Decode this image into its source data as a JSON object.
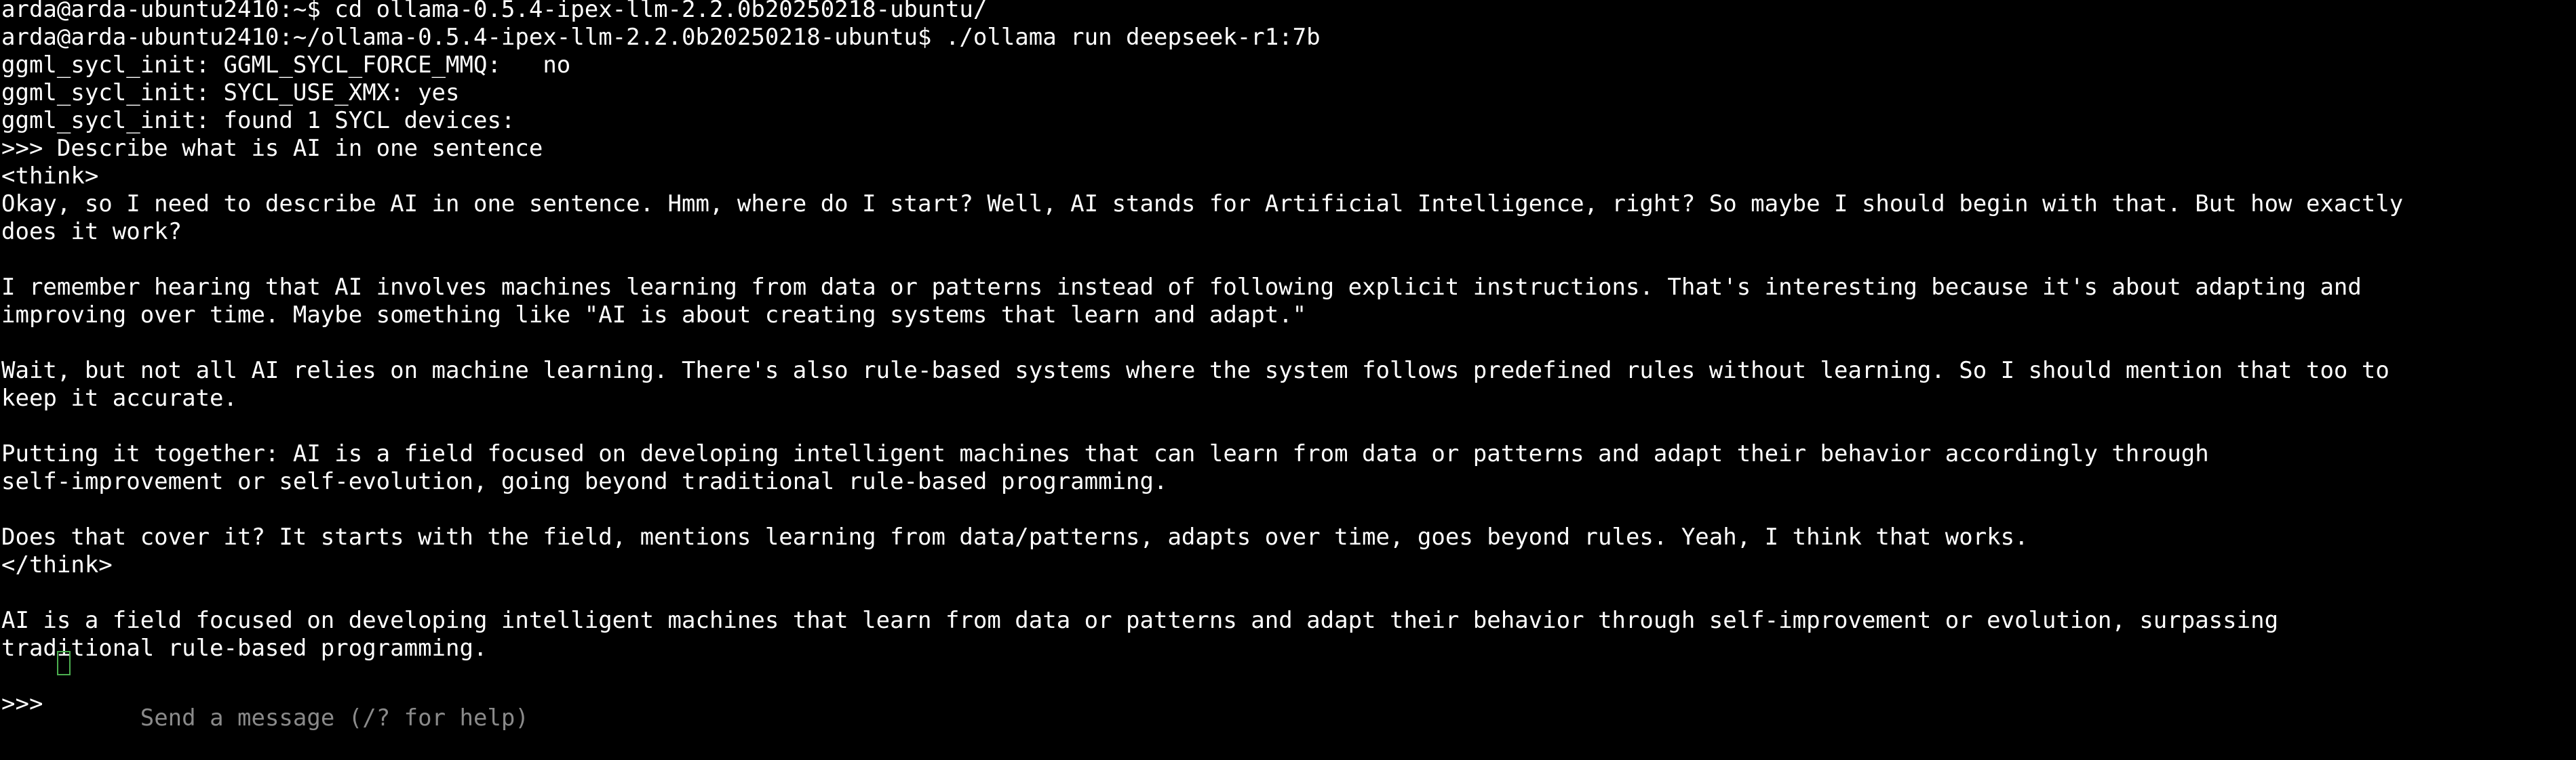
{
  "terminal": {
    "lines": [
      "arda@arda-ubuntu2410:~$ cd ollama-0.5.4-ipex-llm-2.2.0b20250218-ubuntu/",
      "arda@arda-ubuntu2410:~/ollama-0.5.4-ipex-llm-2.2.0b20250218-ubuntu$ ./ollama run deepseek-r1:7b",
      "ggml_sycl_init: GGML_SYCL_FORCE_MMQ:   no",
      "ggml_sycl_init: SYCL_USE_XMX: yes",
      "ggml_sycl_init: found 1 SYCL devices:",
      ">>> Describe what is AI in one sentence",
      "<think>",
      "Okay, so I need to describe AI in one sentence. Hmm, where do I start? Well, AI stands for Artificial Intelligence, right? So maybe I should begin with that. But how exactly",
      "does it work?",
      "",
      "I remember hearing that AI involves machines learning from data or patterns instead of following explicit instructions. That's interesting because it's about adapting and",
      "improving over time. Maybe something like \"AI is about creating systems that learn and adapt.\"",
      "",
      "Wait, but not all AI relies on machine learning. There's also rule-based systems where the system follows predefined rules without learning. So I should mention that too to",
      "keep it accurate.",
      "",
      "Putting it together: AI is a field focused on developing intelligent machines that can learn from data or patterns and adapt their behavior accordingly through",
      "self-improvement or self-evolution, going beyond traditional rule-based programming.",
      "",
      "Does that cover it? It starts with the field, mentions learning from data/patterns, adapts over time, goes beyond rules. Yeah, I think that works.",
      "</think>",
      "",
      "AI is a field focused on developing intelligent machines that learn from data or patterns and adapt their behavior through self-improvement or evolution, surpassing",
      "traditional rule-based programming.",
      ""
    ],
    "input_prompt": ">>> ",
    "input_placeholder": "Send a message (/? for help)"
  },
  "colors": {
    "background": "#000000",
    "text": "#ffffff",
    "placeholder": "#8a8a8a",
    "cursor": "#4caf50"
  }
}
